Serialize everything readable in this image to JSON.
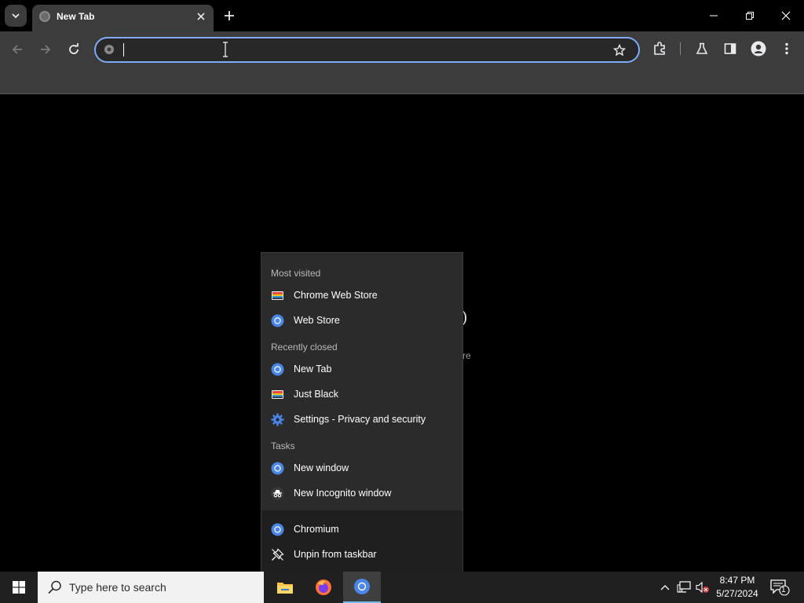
{
  "browser": {
    "tab": {
      "title": "New Tab"
    },
    "omnibox": {
      "value": "",
      "placeholder": ""
    },
    "window_controls": {
      "minimize": "minimize-icon",
      "restore": "restore-icon",
      "close": "close-icon"
    }
  },
  "jumplist": {
    "sections": [
      {
        "heading": "Most visited",
        "items": [
          {
            "label": "Chrome Web Store",
            "icon": "rainbow-icon"
          },
          {
            "label": "Web Store",
            "icon": "chromium-icon"
          }
        ]
      },
      {
        "heading": "Recently closed",
        "items": [
          {
            "label": "New Tab",
            "icon": "chromium-icon"
          },
          {
            "label": "Just Black",
            "icon": "rainbow-icon"
          },
          {
            "label": "Settings - Privacy and security",
            "icon": "gear-icon"
          }
        ]
      },
      {
        "heading": "Tasks",
        "items": [
          {
            "label": "New window",
            "icon": "chromium-icon"
          },
          {
            "label": "New Incognito window",
            "icon": "incognito-icon"
          }
        ]
      }
    ],
    "pinned": [
      {
        "label": "Chromium",
        "icon": "chromium-icon"
      },
      {
        "label": "Unpin from taskbar",
        "icon": "unpin-icon"
      }
    ]
  },
  "taskbar": {
    "search_placeholder": "Type here to search",
    "clock": {
      "time": "8:47 PM",
      "date": "5/27/2024"
    },
    "notification_count": "1"
  },
  "colors": {
    "accent": "#7cacf8",
    "taskbar_active": "#76b9ed",
    "toolbar": "#3c3c3c"
  }
}
